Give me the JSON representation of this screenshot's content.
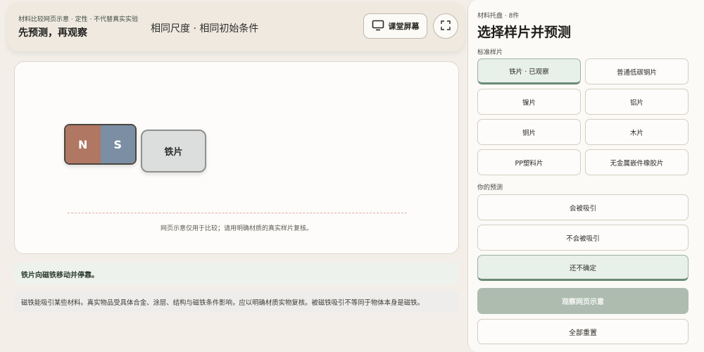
{
  "header": {
    "subtitle": "材料比较网页示意 · 定性 · 不代替真实实验",
    "title": "先预测，再观察",
    "center_text": "相同尺度 · 相同初始条件",
    "screen_button_label": "课堂屏幕",
    "screen_icon": "monitor-icon",
    "fullscreen_icon": "fullscreen-icon"
  },
  "stage": {
    "magnet_north": "N",
    "magnet_south": "S",
    "sample_label": "铁片",
    "note": "网页示意仅用于比较；请用明确材质的真实样片复核。"
  },
  "result_text": "铁片向磁铁移动并停靠。",
  "explanation_text": "磁铁能吸引某些材料。真实物品受具体合金、涂层、结构与磁铁条件影响，应以明确材质实物复核。被磁铁吸引不等同于物体本身是磁铁。",
  "panel": {
    "subtitle": "材料托盘 · 8件",
    "title": "选择样片并预测",
    "samples_heading": "标准样片",
    "samples": [
      {
        "label": "铁片 · 已观察",
        "selected": true
      },
      {
        "label": "普通低碳钢片",
        "selected": false
      },
      {
        "label": "镍片",
        "selected": false
      },
      {
        "label": "铝片",
        "selected": false
      },
      {
        "label": "铜片",
        "selected": false
      },
      {
        "label": "木片",
        "selected": false
      },
      {
        "label": "PP塑料片",
        "selected": false
      },
      {
        "label": "无金属嵌件橡胶片",
        "selected": false
      }
    ],
    "prediction_heading": "你的预测",
    "predictions": [
      {
        "label": "会被吸引",
        "selected": false
      },
      {
        "label": "不会被吸引",
        "selected": false
      },
      {
        "label": "还不确定",
        "selected": true
      }
    ],
    "observe_button": "观察网页示意",
    "reset_button": "全部重置"
  },
  "colors": {
    "background": "#f3efe8",
    "accent_green": "#6a8a75",
    "magnet_north": "#b07762",
    "magnet_south": "#7b8ea3"
  }
}
